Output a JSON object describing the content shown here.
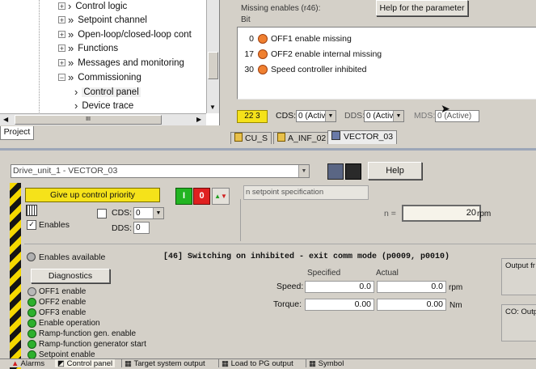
{
  "tree": {
    "items": [
      {
        "label": "Control logic",
        "expander": "+"
      },
      {
        "label": "Setpoint channel",
        "expander": "+"
      },
      {
        "label": "Open-loop/closed-loop cont",
        "expander": "+"
      },
      {
        "label": "Functions",
        "expander": "+"
      },
      {
        "label": "Messages and monitoring",
        "expander": "+"
      },
      {
        "label": "Commissioning",
        "expander": "−"
      },
      {
        "label": "Control panel",
        "expander": ""
      },
      {
        "label": "Device trace",
        "expander": ""
      }
    ],
    "scroll_thumb_glyph": "III",
    "project_tab": "Project"
  },
  "params": {
    "missing_title": "Missing enables (r46):",
    "bit_header": "Bit",
    "help_button": "Help for the parameter",
    "rows": [
      {
        "bit": "0",
        "text": "OFF1 enable missing"
      },
      {
        "bit": "17",
        "text": "OFF2 enable internal missing"
      },
      {
        "bit": "30",
        "text": "Speed controller inhibited"
      }
    ]
  },
  "statusbar": {
    "drive_no": "22 3",
    "cds_label": "CDS:",
    "cds_value": "0 (Activ",
    "dds_label": "DDS:",
    "dds_value": "0 (Activ",
    "mds_label": "MDS:",
    "mds_value": "0 (Active)"
  },
  "tabs": [
    {
      "label": "CU_S"
    },
    {
      "label": "A_INF_02"
    },
    {
      "label": "VECTOR_03"
    }
  ],
  "panel": {
    "drive_select": "Drive_unit_1 - VECTOR_03",
    "help_button": "Help",
    "give_up_button": "Give up control priority",
    "on_button": "I",
    "off_button": "0",
    "setpoint_spec": "n setpoint specification",
    "enables_label": "Enables",
    "cds_label": "CDS:",
    "cds_value": "0",
    "dds_label": "DDS:",
    "dds_value": "0",
    "n_label": "n =",
    "n_value": "20",
    "n_unit": "rpm",
    "enables_available": "Enables available",
    "message": "[46] Switching on inhibited - exit comm mode (p0009, p0010)",
    "diagnostics_button": "Diagnostics",
    "specified_header": "Specified",
    "actual_header": "Actual",
    "speed_label": "Speed:",
    "speed_specified": "0.0",
    "speed_actual": "0.0",
    "speed_unit": "rpm",
    "torque_label": "Torque:",
    "torque_specified": "0.00",
    "torque_actual": "0.00",
    "torque_unit": "Nm",
    "enables": [
      "OFF1 enable",
      "OFF2 enable",
      "OFF3 enable",
      "Enable operation",
      "Ramp-function gen. enable",
      "Ramp-function generator start",
      "Setpoint enable"
    ],
    "output_box": "Output fr",
    "co_output": "CO: Outp"
  },
  "bottom_tabs": [
    {
      "label": "Alarms"
    },
    {
      "label": "Control panel"
    },
    {
      "label": "Target system output"
    },
    {
      "label": "Load to PG output"
    },
    {
      "label": "Symbol"
    }
  ],
  "colors": {
    "accent_yellow": "#f5e21a",
    "on_green": "#22b422",
    "off_red": "#e02020",
    "led_orange": "#f08030",
    "led_green": "#2db02d"
  }
}
